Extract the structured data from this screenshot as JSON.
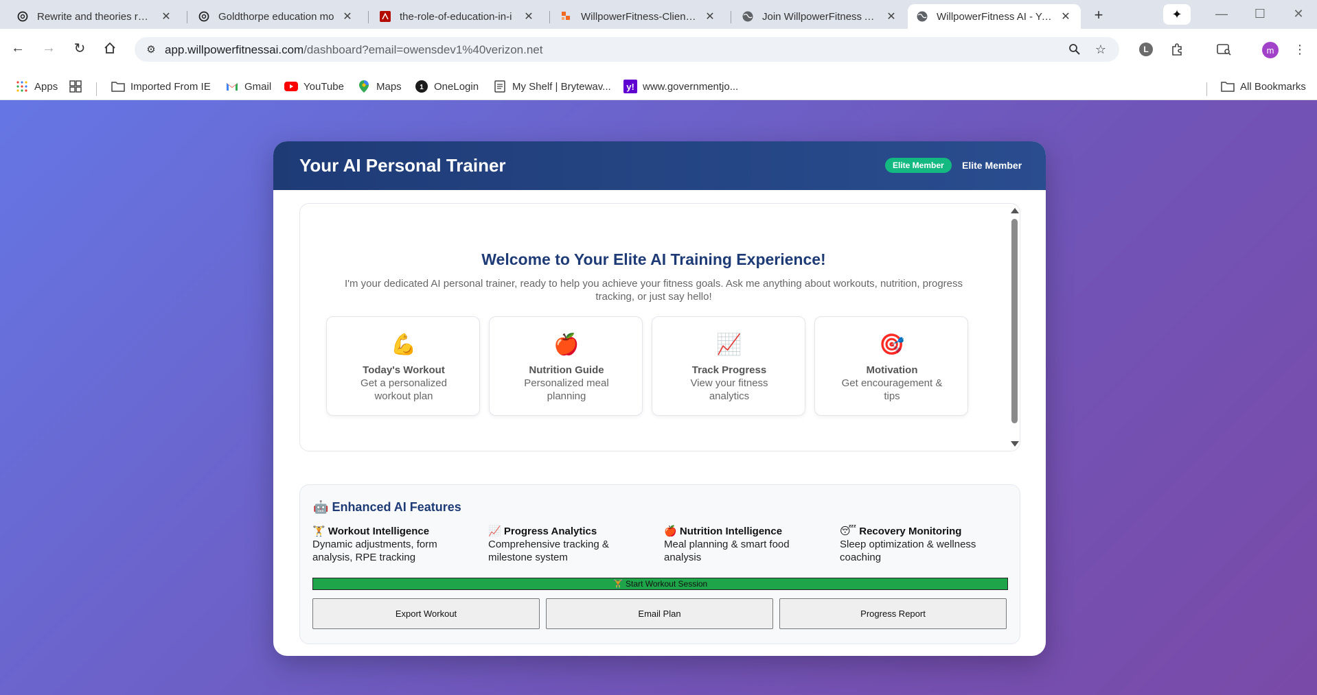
{
  "browser": {
    "tabs": [
      {
        "title": "Rewrite and theories requ",
        "icon": "openai-icon"
      },
      {
        "title": "Goldthorpe education mo",
        "icon": "openai-icon"
      },
      {
        "title": "the-role-of-education-in-i",
        "icon": "pdf-icon"
      },
      {
        "title": "WillpowerFitness-Client-P",
        "icon": "bolt-icon"
      },
      {
        "title": "Join WillpowerFitness AI -",
        "icon": "globe-icon"
      },
      {
        "title": "WillpowerFitness AI - Your",
        "icon": "globe-icon",
        "active": true
      }
    ],
    "url_host": "app.willpowerfitnessai.com",
    "url_rest": "/dashboard?email=owensdev1%40verizon.net",
    "avatar_initial": "m",
    "bookmarks": [
      {
        "label": "Apps",
        "icon": "apps-grid-icon"
      },
      {
        "label": "Imported From IE",
        "icon": "folder-icon"
      },
      {
        "label": "Gmail",
        "icon": "gmail-icon"
      },
      {
        "label": "YouTube",
        "icon": "youtube-icon"
      },
      {
        "label": "Maps",
        "icon": "maps-icon"
      },
      {
        "label": "OneLogin",
        "icon": "onelogin-icon"
      },
      {
        "label": "My Shelf | Brytewav...",
        "icon": "document-icon"
      },
      {
        "label": "www.governmentjo...",
        "icon": "yahoo-icon"
      }
    ],
    "all_bookmarks": "All Bookmarks"
  },
  "app": {
    "title": "Your AI Personal Trainer",
    "badge": "Elite Member",
    "member_label": "Elite Member",
    "accent_color": "#13b981",
    "header_color": "#1e3b76"
  },
  "welcome": {
    "title": "Welcome to Your Elite AI Training Experience!",
    "text": "I'm your dedicated AI personal trainer, ready to help you achieve your fitness goals. Ask me anything about workouts, nutrition, progress tracking, or just say hello!"
  },
  "quick_actions": [
    {
      "emoji": "💪",
      "title": "Today's Workout",
      "desc": "Get a personalized workout plan",
      "icon": "flexed-biceps-icon"
    },
    {
      "emoji": "🍎",
      "title": "Nutrition Guide",
      "desc": "Personalized meal planning",
      "icon": "apple-icon"
    },
    {
      "emoji": "📈",
      "title": "Track Progress",
      "desc": "View your fitness analytics",
      "icon": "chart-increasing-icon"
    },
    {
      "emoji": "🎯",
      "title": "Motivation",
      "desc": "Get encouragement & tips",
      "icon": "target-icon"
    }
  ],
  "features": {
    "emoji": "🤖",
    "title": "Enhanced AI Features",
    "items": [
      {
        "emoji": "🏋",
        "title": "Workout Intelligence",
        "desc": "Dynamic adjustments, form analysis, RPE tracking"
      },
      {
        "emoji": "📈",
        "title": "Progress Analytics",
        "desc": "Comprehensive tracking & milestone system"
      },
      {
        "emoji": "🍎",
        "title": "Nutrition Intelligence",
        "desc": "Meal planning & smart food analysis"
      },
      {
        "emoji": "😴",
        "title": "Recovery Monitoring",
        "desc": "Sleep optimization & wellness coaching"
      }
    ],
    "start_button": "🏋 Start Workout Session",
    "actions": [
      "Export Workout",
      "Email Plan",
      "Progress Report"
    ]
  }
}
